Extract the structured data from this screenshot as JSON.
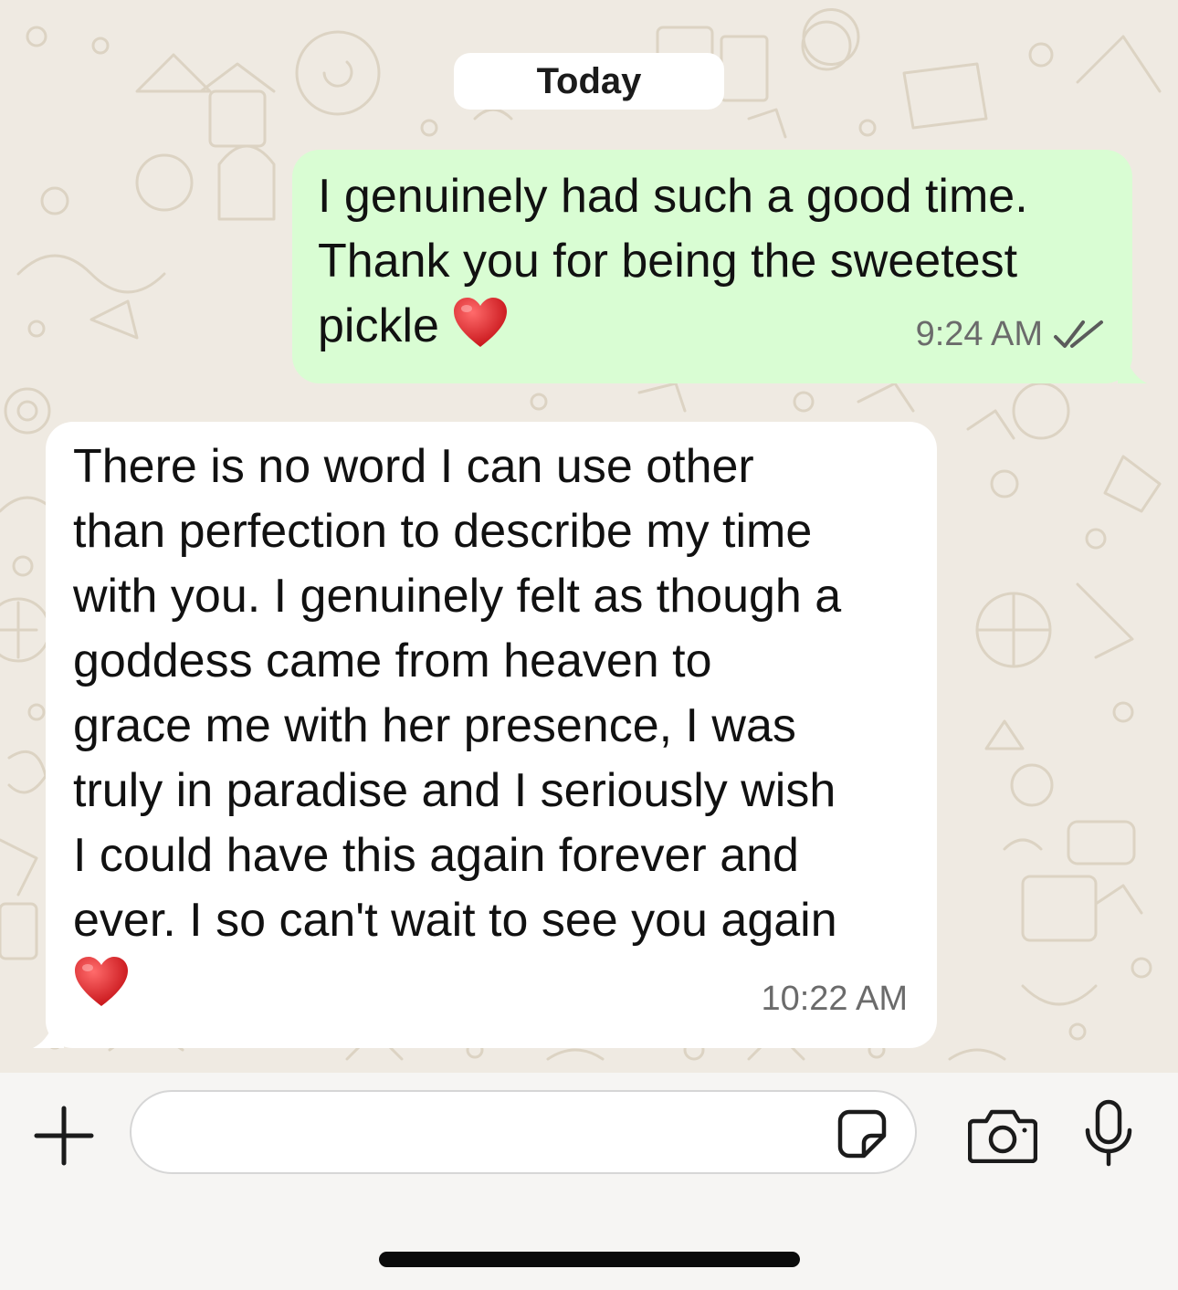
{
  "day_separator": "Today",
  "messages": [
    {
      "direction": "outgoing",
      "text": "I genuinely had such a good time.\nThank you for being the sweetest\npickle",
      "emoji": "red-heart",
      "time": "9:24 AM",
      "status": "read-double-check"
    },
    {
      "direction": "incoming",
      "text": "There is no word I can use other\nthan perfection to describe my time\nwith you. I genuinely felt as though a\ngoddess came from heaven to\ngrace me with her presence, I was\ntruly in paradise and I seriously wish\nI could have this again forever and\never. I so can't wait to see you again",
      "emoji": "red-heart",
      "time": "10:22 AM"
    }
  ],
  "composer": {
    "placeholder": "",
    "icons": [
      "plus-icon",
      "sticker-icon",
      "camera-icon",
      "microphone-icon"
    ]
  },
  "colors": {
    "chat_background": "#efeae2",
    "outgoing_bubble": "#d9fdd3",
    "incoming_bubble": "#ffffff",
    "heart": "#e0312f"
  }
}
